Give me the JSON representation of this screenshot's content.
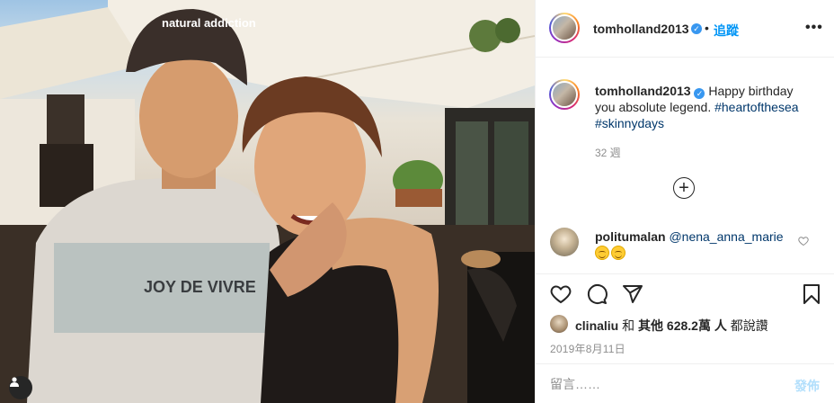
{
  "post": {
    "author": "tomholland2013",
    "follow_label": "追蹤",
    "separator": "•",
    "more_label": "•••"
  },
  "caption": {
    "username": "tomholland2013",
    "text": "Happy birthday you absolute legend.",
    "hashtags": [
      "#heartofthesea",
      "#skinnydays"
    ],
    "time": "32 週"
  },
  "photo": {
    "cap_text": "natural addiction",
    "shirt_text": "JOY DE VIVRE"
  },
  "comment": {
    "username": "politumalan",
    "mention": "@nena_anna_marie",
    "emoji_count": 2
  },
  "likes": {
    "user": "clinaliu",
    "text_and": "和",
    "text_others": "其他",
    "count": "628.2萬",
    "text_people": "人",
    "text_liked": "都說讚"
  },
  "date": "2019年8月11日",
  "comment_input": {
    "placeholder": "留言……",
    "post_label": "發佈"
  },
  "colors": {
    "accent": "#0095f6",
    "hashtag": "#00376b",
    "verified": "#3897f0",
    "post_disabled": "#b2dffc"
  },
  "icons": [
    "heart-icon",
    "comment-icon",
    "share-icon",
    "bookmark-icon",
    "plus-circle-icon",
    "verified-icon",
    "more-icon",
    "user-tag-icon"
  ]
}
